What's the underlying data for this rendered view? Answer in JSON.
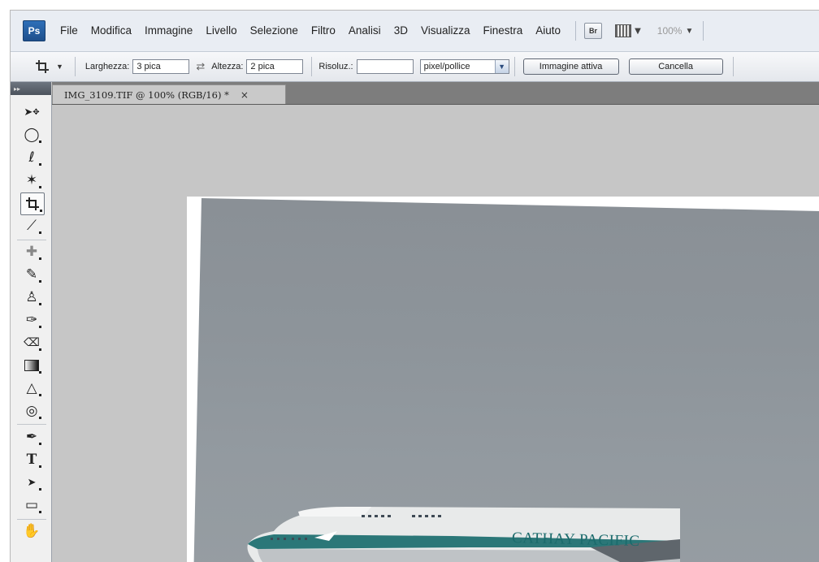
{
  "app": {
    "logo_text": "Ps"
  },
  "menubar": {
    "items": [
      "File",
      "Modifica",
      "Immagine",
      "Livello",
      "Selezione",
      "Filtro",
      "Analisi",
      "3D",
      "Visualizza",
      "Finestra",
      "Aiuto"
    ],
    "bridge_label": "Br",
    "zoom_value": "100%"
  },
  "options_bar": {
    "width_label": "Larghezza:",
    "width_value": "3 pica",
    "height_label": "Altezza:",
    "height_value": "2 pica",
    "resolution_label": "Risoluz.:",
    "resolution_value": "",
    "units_selected": "pixel/pollice",
    "front_image_button": "Immagine attiva",
    "clear_button": "Cancella"
  },
  "toolbox": {
    "collapse_glyph": "▸▸",
    "tools": [
      {
        "name": "move",
        "glyph": "➤"
      },
      {
        "name": "marquee",
        "glyph": "◯"
      },
      {
        "name": "lasso",
        "glyph": "ℓ"
      },
      {
        "name": "magic-wand",
        "glyph": "✶"
      },
      {
        "name": "crop",
        "glyph": "⌗"
      },
      {
        "name": "eyedropper",
        "glyph": "⟋"
      },
      {
        "name": "healing",
        "glyph": "✚"
      },
      {
        "name": "brush",
        "glyph": "✎"
      },
      {
        "name": "clone-stamp",
        "glyph": "♙"
      },
      {
        "name": "history-brush",
        "glyph": "✑"
      },
      {
        "name": "eraser",
        "glyph": "⌫"
      },
      {
        "name": "gradient",
        "glyph": "▮"
      },
      {
        "name": "blur",
        "glyph": "△"
      },
      {
        "name": "dodge",
        "glyph": "◎"
      },
      {
        "name": "pen",
        "glyph": "✒"
      },
      {
        "name": "type",
        "glyph": "T"
      },
      {
        "name": "path-selection",
        "glyph": "➤"
      },
      {
        "name": "shape",
        "glyph": "▭"
      },
      {
        "name": "hand",
        "glyph": "✋"
      }
    ]
  },
  "document": {
    "tab_title": "IMG_3109.TIF @ 100% (RGB/16) *",
    "close_glyph": "×"
  },
  "photo": {
    "airline_text": "CATHAY PACIFIC"
  },
  "colors": {
    "menubar_bg": "#e9edf3",
    "canvas_bg": "#c6c6c6",
    "ps_logo": "#2e6fb8",
    "airline_teal": "#1b6b6c"
  }
}
